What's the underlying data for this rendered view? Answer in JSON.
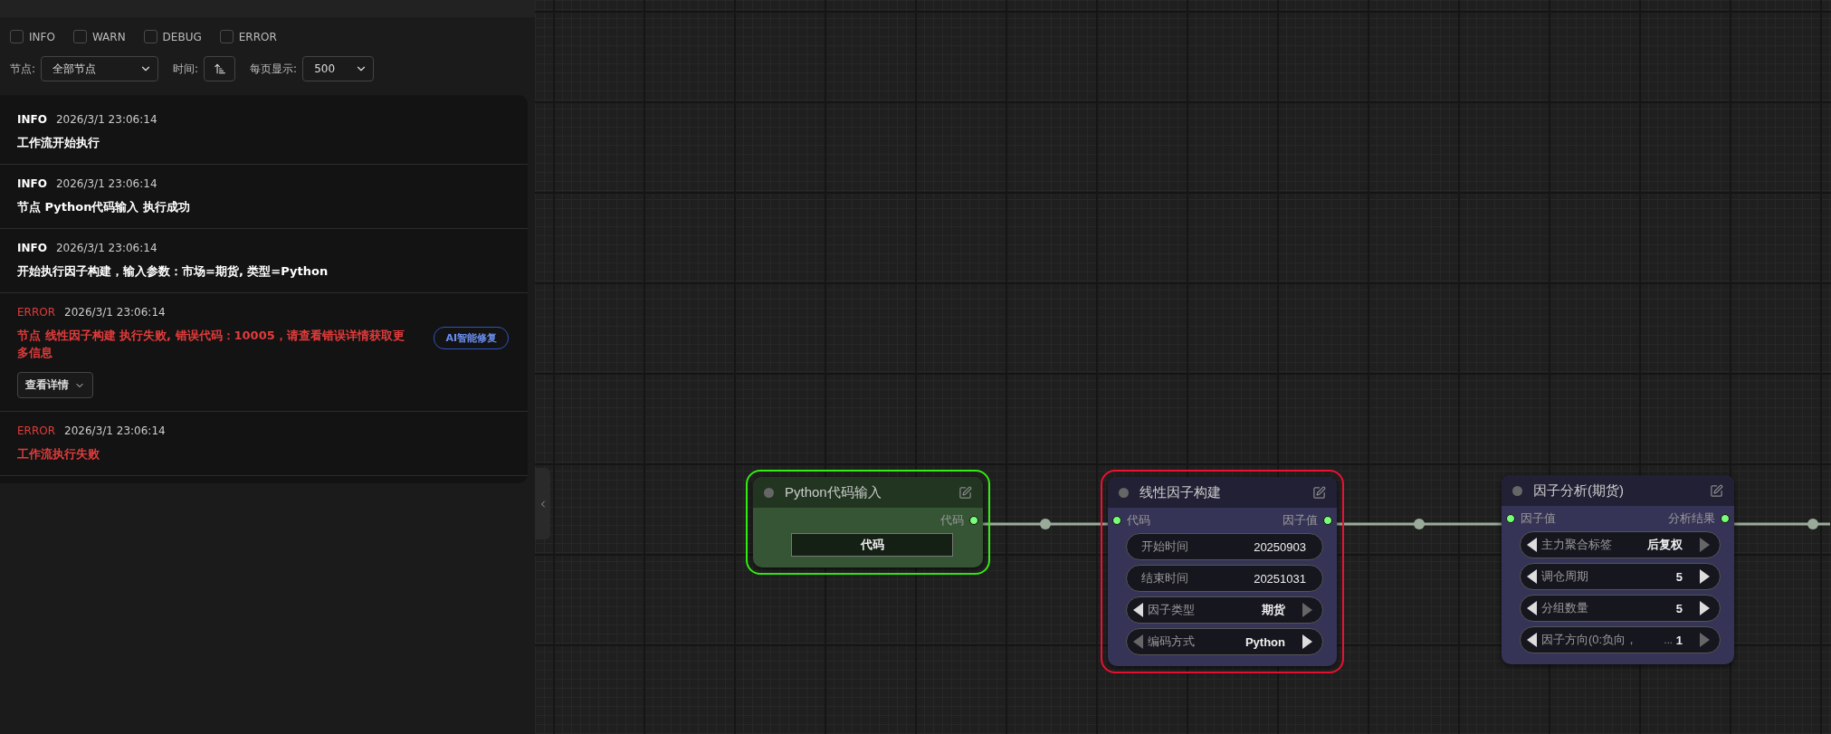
{
  "sidebar": {
    "level_filters": [
      {
        "label": "INFO",
        "checked": false
      },
      {
        "label": "WARN",
        "checked": false
      },
      {
        "label": "DEBUG",
        "checked": false
      },
      {
        "label": "ERROR",
        "checked": false
      }
    ],
    "filters": {
      "node_label": "节点:",
      "node_value": "全部节点",
      "time_label": "时间:",
      "page_size_label": "每页显示:",
      "page_size_value": "500"
    },
    "logs": [
      {
        "kind": "info",
        "level": "INFO",
        "time": "2026/3/1 23:06:14",
        "message": "工作流开始执行"
      },
      {
        "kind": "info",
        "level": "INFO",
        "time": "2026/3/1 23:06:14",
        "message": "节点 Python代码输入 执行成功"
      },
      {
        "kind": "info",
        "level": "INFO",
        "time": "2026/3/1 23:06:14",
        "message": "开始执行因子构建，输入参数：市场=期货, 类型=Python"
      },
      {
        "kind": "error",
        "level": "ERROR",
        "time": "2026/3/1 23:06:14",
        "message": "节点 线性因子构建 执行失败, 错误代码：10005，请查看错误详情获取更多信息",
        "action": "AI智能修复",
        "details": "查看详情"
      },
      {
        "kind": "error",
        "level": "ERROR",
        "time": "2026/3/1 23:06:14",
        "message": "工作流执行失败"
      }
    ]
  },
  "canvas": {
    "nodes": [
      {
        "title": "Python代码输入",
        "succeeded": true,
        "failed": false,
        "color": "#355535",
        "outputs": [
          "代码"
        ],
        "widgets": [
          {
            "kind": "textbox",
            "value": "代码"
          }
        ]
      },
      {
        "title": "线性因子构建",
        "succeeded": false,
        "failed": true,
        "color": "#353456",
        "inputs": [
          "代码"
        ],
        "outputs": [
          "因子值"
        ],
        "widgets": [
          {
            "kind": "number",
            "label": "开始时间",
            "value": "20250903"
          },
          {
            "kind": "number",
            "label": "结束时间",
            "value": "20251031"
          },
          {
            "kind": "combo",
            "label": "因子类型",
            "value": "期货",
            "prev_enabled": true,
            "next_enabled": false
          },
          {
            "kind": "combo",
            "label": "编码方式",
            "value": "Python",
            "prev_enabled": false,
            "next_enabled": true
          }
        ]
      },
      {
        "title": "因子分析(期货)",
        "succeeded": false,
        "failed": false,
        "color": "#353456",
        "inputs": [
          "因子值"
        ],
        "outputs": [
          "分析结果"
        ],
        "widgets": [
          {
            "kind": "combo",
            "label": "主力聚合标签",
            "value": "后复权",
            "prev_enabled": true,
            "next_enabled": false
          },
          {
            "kind": "combo",
            "label": "调仓周期",
            "value": "5",
            "prev_enabled": true,
            "next_enabled": true
          },
          {
            "kind": "combo",
            "label": "分组数量",
            "value": "5",
            "prev_enabled": true,
            "next_enabled": true
          },
          {
            "kind": "combo",
            "label": "因子方向(0:负向，",
            "overflow_mark": "...",
            "value": "1",
            "prev_enabled": true,
            "next_enabled": false
          }
        ]
      }
    ]
  }
}
